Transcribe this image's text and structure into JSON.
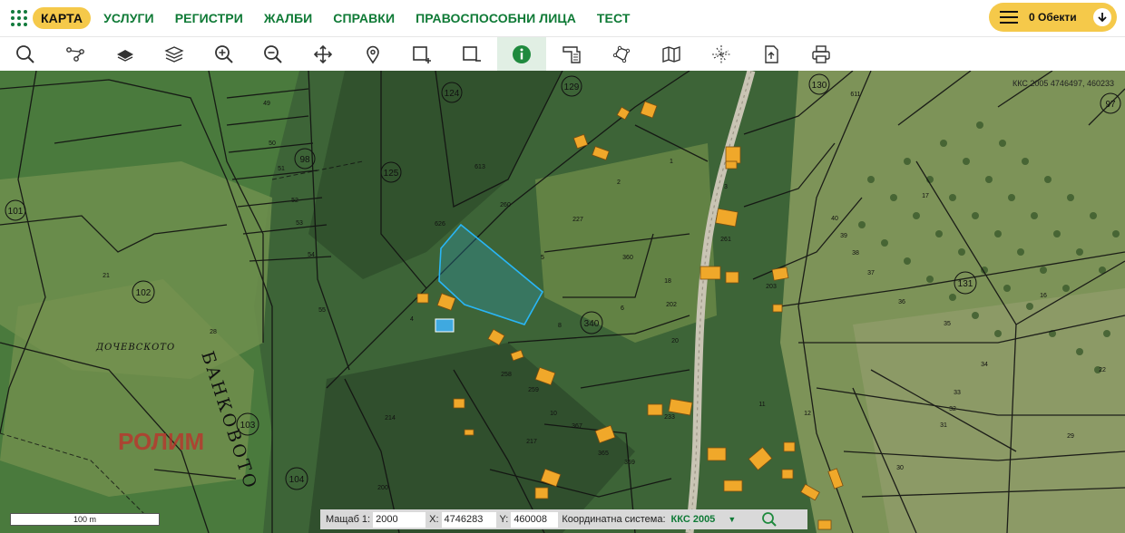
{
  "nav": {
    "items": [
      {
        "label": "КАРТА",
        "active": true
      },
      {
        "label": "УСЛУГИ",
        "active": false
      },
      {
        "label": "РЕГИСТРИ",
        "active": false
      },
      {
        "label": "ЖАЛБИ",
        "active": false
      },
      {
        "label": "СПРАВКИ",
        "active": false
      },
      {
        "label": "ПРАВОСПОСОБНИ ЛИЦА",
        "active": false
      },
      {
        "label": "ТЕСТ",
        "active": false
      }
    ],
    "objects_label": "0 Обекти",
    "accent": "#f5c94a",
    "link_color": "#0f7a36"
  },
  "toolbar": {
    "tools": [
      {
        "icon": "search-icon",
        "active": false
      },
      {
        "icon": "route-icon",
        "active": false
      },
      {
        "icon": "layer-icon",
        "active": false
      },
      {
        "icon": "layers-stack-icon",
        "active": false
      },
      {
        "icon": "zoom-in-icon",
        "active": false
      },
      {
        "icon": "zoom-out-icon",
        "active": false
      },
      {
        "icon": "pan-icon",
        "active": false
      },
      {
        "icon": "map-pin-icon",
        "active": false
      },
      {
        "icon": "select-add-icon",
        "active": false
      },
      {
        "icon": "select-remove-icon",
        "active": false
      },
      {
        "icon": "info-icon",
        "active": true
      },
      {
        "icon": "measure-area-icon",
        "active": false
      },
      {
        "icon": "polygon-draw-icon",
        "active": false
      },
      {
        "icon": "map-icon",
        "active": false
      },
      {
        "icon": "crosshair-grid-icon",
        "active": false
      },
      {
        "icon": "export-icon",
        "active": false
      },
      {
        "icon": "print-icon",
        "active": false
      }
    ]
  },
  "map": {
    "coord_readout": "ККС 2005 4746497, 460233",
    "place_labels": [
      "РОЛИМ",
      "БАНКОВОТО",
      "ДОЧЕВСКОТО"
    ],
    "parcel_numbers": [
      "124",
      "129",
      "130",
      "98",
      "125",
      "101",
      "102",
      "103",
      "104",
      "131",
      "340",
      "227",
      "360",
      "261",
      "260",
      "258",
      "259",
      "233",
      "367",
      "365",
      "357",
      "359",
      "217",
      "214",
      "200",
      "202",
      "203",
      "50",
      "51",
      "52",
      "53",
      "54",
      "55",
      "21",
      "28",
      "40",
      "39",
      "38",
      "37",
      "36",
      "35",
      "34",
      "33",
      "32",
      "31",
      "30",
      "29",
      "22",
      "17",
      "16",
      "18",
      "20",
      "10",
      "9",
      "8",
      "6",
      "5",
      "4",
      "1",
      "2",
      "3",
      "11",
      "12",
      "611",
      "613",
      "626"
    ],
    "selected_parcel_color": "#29b6f6",
    "building_color": "#f0a82a"
  },
  "scalebar": {
    "label": "100 m"
  },
  "infobar": {
    "scale_label": "Мащаб 1:",
    "scale_value": "2000",
    "x_label": "X:",
    "x_value": "4746283",
    "y_label": "Y:",
    "y_value": "460008",
    "system_label": "Координатна система:",
    "system_value": "ККС 2005"
  }
}
